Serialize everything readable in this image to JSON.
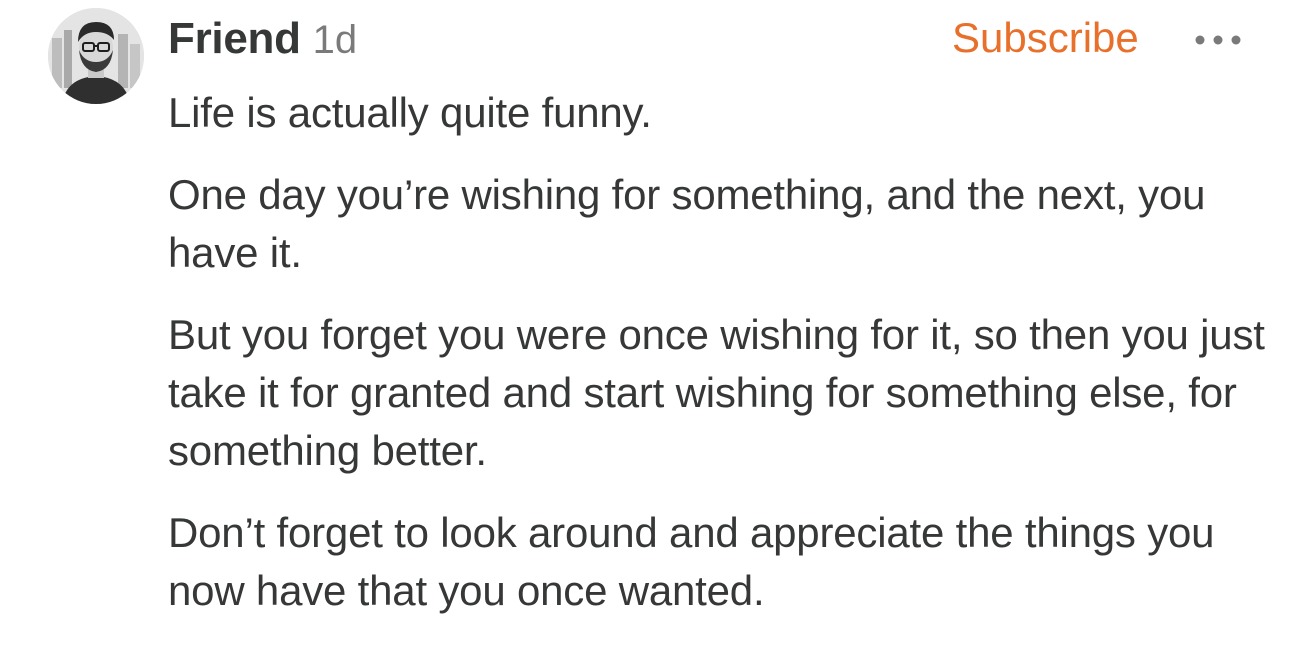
{
  "comment": {
    "author": "Friend",
    "time_ago": "1d",
    "subscribe_label": "Subscribe",
    "more_icon": "more-horizontal-icon",
    "avatar": "avatar-illustration",
    "paragraphs": [
      "Life is actually quite funny.",
      "One day you’re wishing for something, and the next, you have it.",
      "But you forget you were once wishing for it, so then you just take it for granted and start wishing for something else, for something better.",
      "Don’t forget to look around and appreciate the things you now have that you once wanted."
    ]
  },
  "colors": {
    "accent": "#e8702a",
    "text": "#363737",
    "muted": "#7a7a7a"
  }
}
